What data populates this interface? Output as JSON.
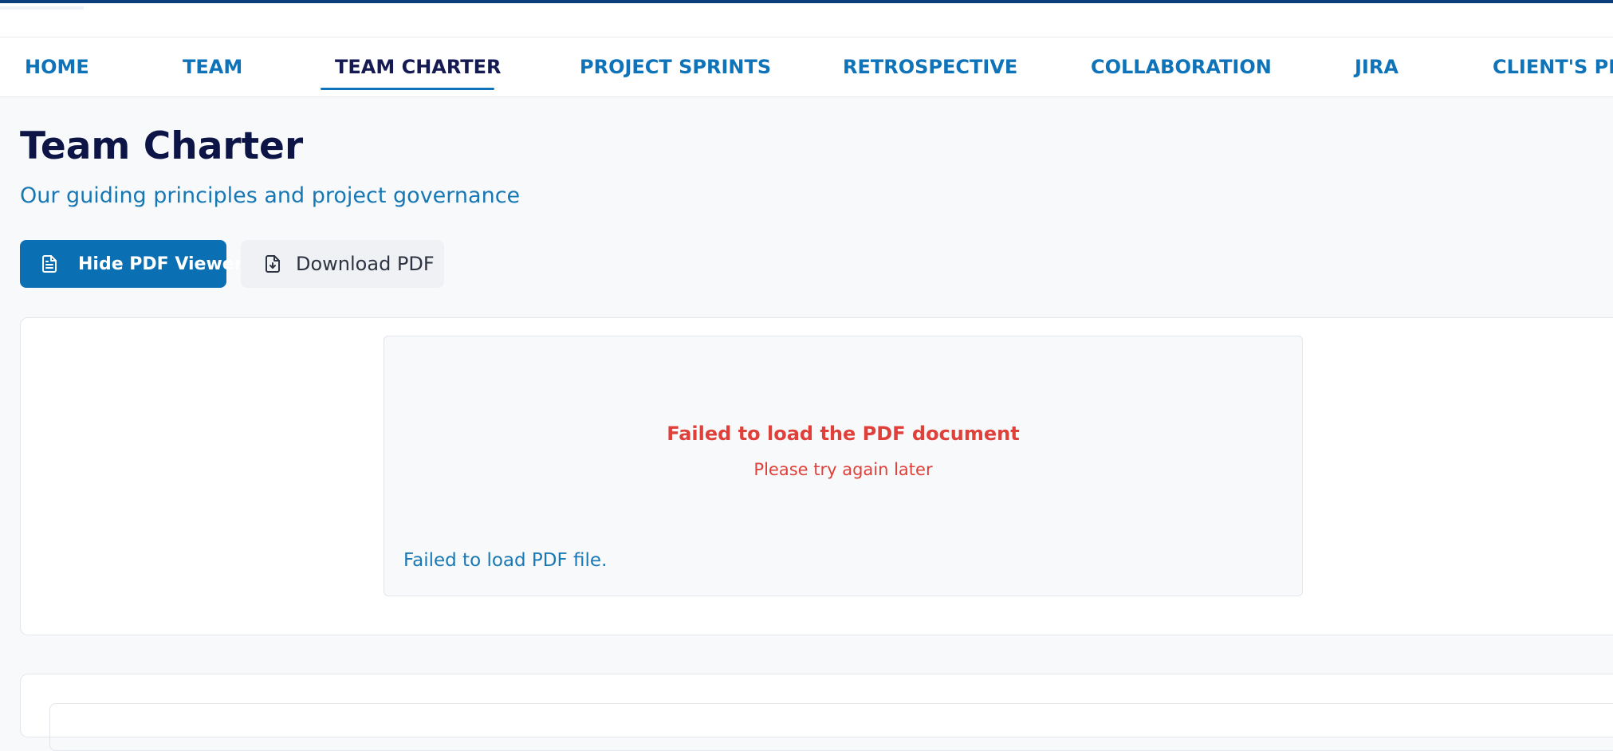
{
  "nav": {
    "items": [
      {
        "label": "HOME"
      },
      {
        "label": "TEAM"
      },
      {
        "label": "TEAM CHARTER"
      },
      {
        "label": "PROJECT SPRINTS"
      },
      {
        "label": "RETROSPECTIVE"
      },
      {
        "label": "COLLABORATION"
      },
      {
        "label": "JIRA"
      },
      {
        "label": "CLIENT'S PRO"
      }
    ],
    "active": "TEAM CHARTER"
  },
  "page": {
    "title": "Team Charter",
    "subtitle": "Our guiding principles and project governance"
  },
  "actions": {
    "hide_pdf_label": "Hide PDF Viewer",
    "hide_pdf_icon": "document-icon",
    "download_pdf_label": "Download PDF",
    "download_pdf_icon": "file-download-icon"
  },
  "pdf_viewer": {
    "error_title": "Failed to load the PDF document",
    "error_subtitle": "Please try again later",
    "fallback_text": "Failed to load PDF file."
  },
  "colors": {
    "primary": "#0b6fb3",
    "nav_link": "#0e73b8",
    "title": "#0d1547",
    "error": "#e0403a",
    "top_border": "#0b3d7a"
  }
}
